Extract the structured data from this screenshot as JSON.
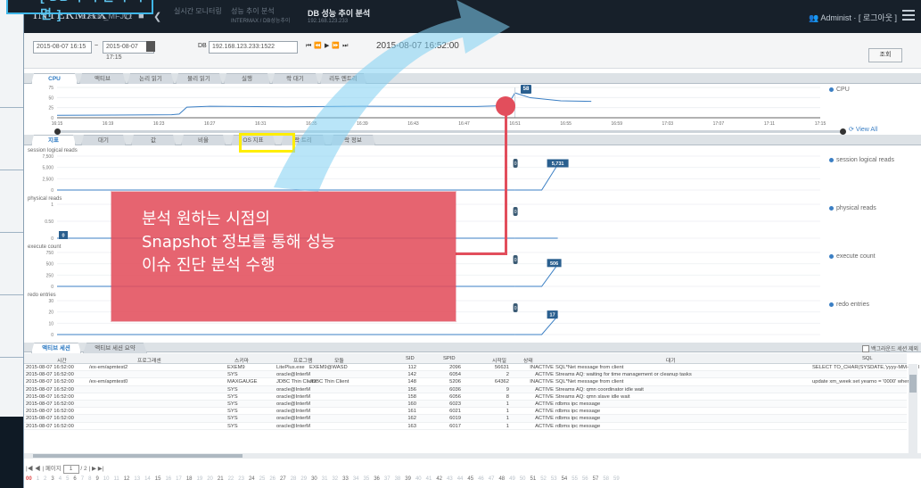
{
  "app": {
    "brand": "INTERMAX",
    "server": "EXEM_MFJ11"
  },
  "breadcrumb": [
    {
      "label": "실시간 모니터링",
      "sub": ""
    },
    {
      "label": "성능 추이 분석",
      "sub": "INTERMAX / DB성능추이"
    }
  ],
  "page_title": "DB 성능 추이 분석",
  "page_title_sub": "192.168.123.233",
  "header": {
    "admin_label": "Administ",
    "logout_label": "[ 로그아웃 ]"
  },
  "top_callout": "[ DB 추이 분석 화면 ]",
  "filters": {
    "from": "2015-08-07 16:15",
    "to": "2015-08-07 17:15",
    "db_label": "DB",
    "db_value": "192.168.123.233:1522",
    "current_time": "2015-08-07 16:52:00",
    "query_button": "조회"
  },
  "upper_tabs": [
    "CPU",
    "액티브",
    "논리 읽기",
    "물리 읽기",
    "실행",
    "락 대기",
    "리두 엔트리"
  ],
  "upper_legend": "CPU",
  "upper_yticks": [
    "75",
    "50",
    "25",
    "0"
  ],
  "upper_xticks": [
    "16:15",
    "16:19",
    "16:23",
    "16:27",
    "16:31",
    "16:35",
    "16:39",
    "16:43",
    "16:47",
    "16:51",
    "16:55",
    "16:59",
    "17:03",
    "17:07",
    "17:11",
    "17:15"
  ],
  "upper_flag": "58",
  "view_all": "View All",
  "lower_tabs": [
    "지표",
    "대기",
    "값",
    "비율",
    "OS 지표",
    "락 트리",
    "락 정보"
  ],
  "lower_series": [
    {
      "name": "session logical reads",
      "yticks": [
        "7,500",
        "5,000",
        "2,500",
        "0"
      ],
      "flag": "5,731"
    },
    {
      "name": "physical reads",
      "yticks": [
        "1",
        "0.50",
        "0"
      ],
      "flag": "0"
    },
    {
      "name": "execute count",
      "yticks": [
        "750",
        "500",
        "250",
        "0"
      ],
      "flag": "506"
    },
    {
      "name": "redo entries",
      "yticks": [
        "30",
        "20",
        "10",
        "0"
      ],
      "flag": "17"
    }
  ],
  "callout": {
    "lines": [
      "분석 원하는 시점의",
      "Snapshot 정보를 통해 성능",
      "이슈 진단 분석 수행"
    ]
  },
  "bottom_tabs": [
    "액티브 세션",
    "액티브 세션 요약"
  ],
  "bottom_checkbox": "백그라운드 세션 제외",
  "grid": {
    "columns": [
      "시간",
      "프로그래센",
      "스키마",
      "프로그램",
      "모듈",
      "SID",
      "SPID",
      "시작일",
      "상태",
      "대기",
      "SQL"
    ],
    "rows": [
      [
        "2015-08-07 16:52:00",
        "/ex-em/apmtest2",
        "EXEM9",
        "LitePlus.exe",
        "EXEM9@WASD",
        "112",
        "2096",
        "56631",
        "INACTIVE",
        "SQL*Net message from client",
        "SELECT TO_CHAR(SYSDATE,'yyyy-MM-dd') F"
      ],
      [
        "2015-08-07 16:52:00",
        "",
        "SYS",
        "oracle@InterM",
        "",
        "142",
        "6054",
        "2",
        "ACTIVE",
        "Streams AQ: waiting for time management or cleanup tasks",
        ""
      ],
      [
        "2015-08-07 16:52:00",
        "/ex-em/apmtest0",
        "MAXGAUGE",
        "JDBC Thin Client",
        "JDBC Thin Client",
        "148",
        "5206",
        "64362",
        "INACTIVE",
        "SQL*Net message from client",
        "update xm_week set yearno = '0000' where"
      ],
      [
        "2015-08-07 16:52:00",
        "",
        "SYS",
        "oracle@InterM",
        "",
        "156",
        "6036",
        "9",
        "ACTIVE",
        "Streams AQ: qmn coordinator idle wait",
        ""
      ],
      [
        "2015-08-07 16:52:00",
        "",
        "SYS",
        "oracle@InterM",
        "",
        "158",
        "6056",
        "8",
        "ACTIVE",
        "Streams AQ: qmn slave idle wait",
        ""
      ],
      [
        "2015-08-07 16:52:00",
        "",
        "SYS",
        "oracle@InterM",
        "",
        "160",
        "6023",
        "1",
        "ACTIVE",
        "rdbms ipc message",
        ""
      ],
      [
        "2015-08-07 16:52:00",
        "",
        "SYS",
        "oracle@InterM",
        "",
        "161",
        "6021",
        "1",
        "ACTIVE",
        "rdbms ipc message",
        ""
      ],
      [
        "2015-08-07 16:52:00",
        "",
        "SYS",
        "oracle@InterM",
        "",
        "162",
        "6019",
        "1",
        "ACTIVE",
        "rdbms ipc message",
        ""
      ],
      [
        "2015-08-07 16:52:00",
        "",
        "SYS",
        "oracle@InterM",
        "",
        "163",
        "6017",
        "1",
        "ACTIVE",
        "rdbms ipc message",
        ""
      ]
    ]
  },
  "pager": {
    "page_label": "페이지",
    "page": "1",
    "total": "/ 2"
  },
  "page_numbers": [
    "00",
    "1",
    "2",
    "3",
    "4",
    "5",
    "6",
    "7",
    "8",
    "9",
    "10",
    "11",
    "12",
    "13",
    "14",
    "15",
    "16",
    "17",
    "18",
    "19",
    "20",
    "21",
    "22",
    "23",
    "24",
    "25",
    "26",
    "27",
    "28",
    "29",
    "30",
    "31",
    "32",
    "33",
    "34",
    "35",
    "36",
    "37",
    "38",
    "39",
    "40",
    "41",
    "42",
    "43",
    "44",
    "45",
    "46",
    "47",
    "48",
    "49",
    "50",
    "51",
    "52",
    "53",
    "54",
    "55",
    "56",
    "57",
    "58",
    "59"
  ],
  "colors": {
    "accent": "#2a78c2",
    "callout": "#e24e5c",
    "highlight": "#ffee00",
    "topbar": "#17202a",
    "arrow": "#3fb6e8"
  }
}
